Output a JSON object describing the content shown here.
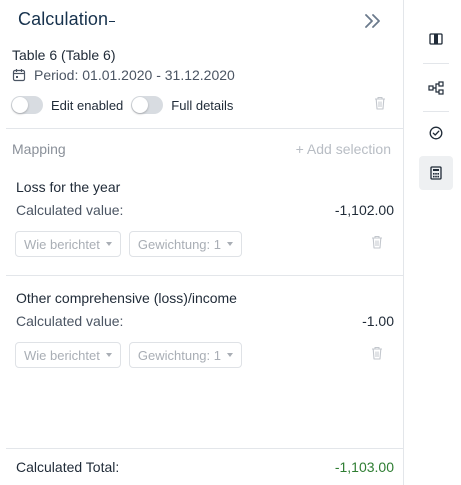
{
  "header": {
    "title": "Calculation",
    "collapse_icon": "double-chevron-right-icon"
  },
  "table": {
    "name": "Table 6 (Table 6)",
    "period": "Period: 01.01.2020 - 31.12.2020"
  },
  "toggles": {
    "edit_enabled": {
      "label": "Edit enabled",
      "on": false
    },
    "full_details": {
      "label": "Full details",
      "on": false
    }
  },
  "mapping": {
    "label": "Mapping",
    "add_selection": "+ Add selection"
  },
  "items": [
    {
      "title": "Loss for the year",
      "calc_label": "Calculated value:",
      "calc_value": "-1,102.00",
      "select_reported": "Wie berichtet",
      "select_weight": "Gewichtung: 1"
    },
    {
      "title": "Other comprehensive (loss)/income",
      "calc_label": "Calculated value:",
      "calc_value": "-1.00",
      "select_reported": "Wie berichtet",
      "select_weight": "Gewichtung: 1"
    }
  ],
  "total": {
    "label": "Calculated Total:",
    "value": "-1,103.00"
  },
  "colors": {
    "title": "#17324d",
    "total_value": "#2e7d32",
    "muted": "#a9aeb5",
    "divider": "#e3e6ea"
  },
  "rail": {
    "buttons": [
      {
        "icon": "column-layout-icon",
        "active": false
      },
      {
        "icon": "hierarchy-tree-icon",
        "active": false
      },
      {
        "icon": "check-circle-icon",
        "active": false
      },
      {
        "icon": "calculator-icon",
        "active": true
      }
    ]
  }
}
